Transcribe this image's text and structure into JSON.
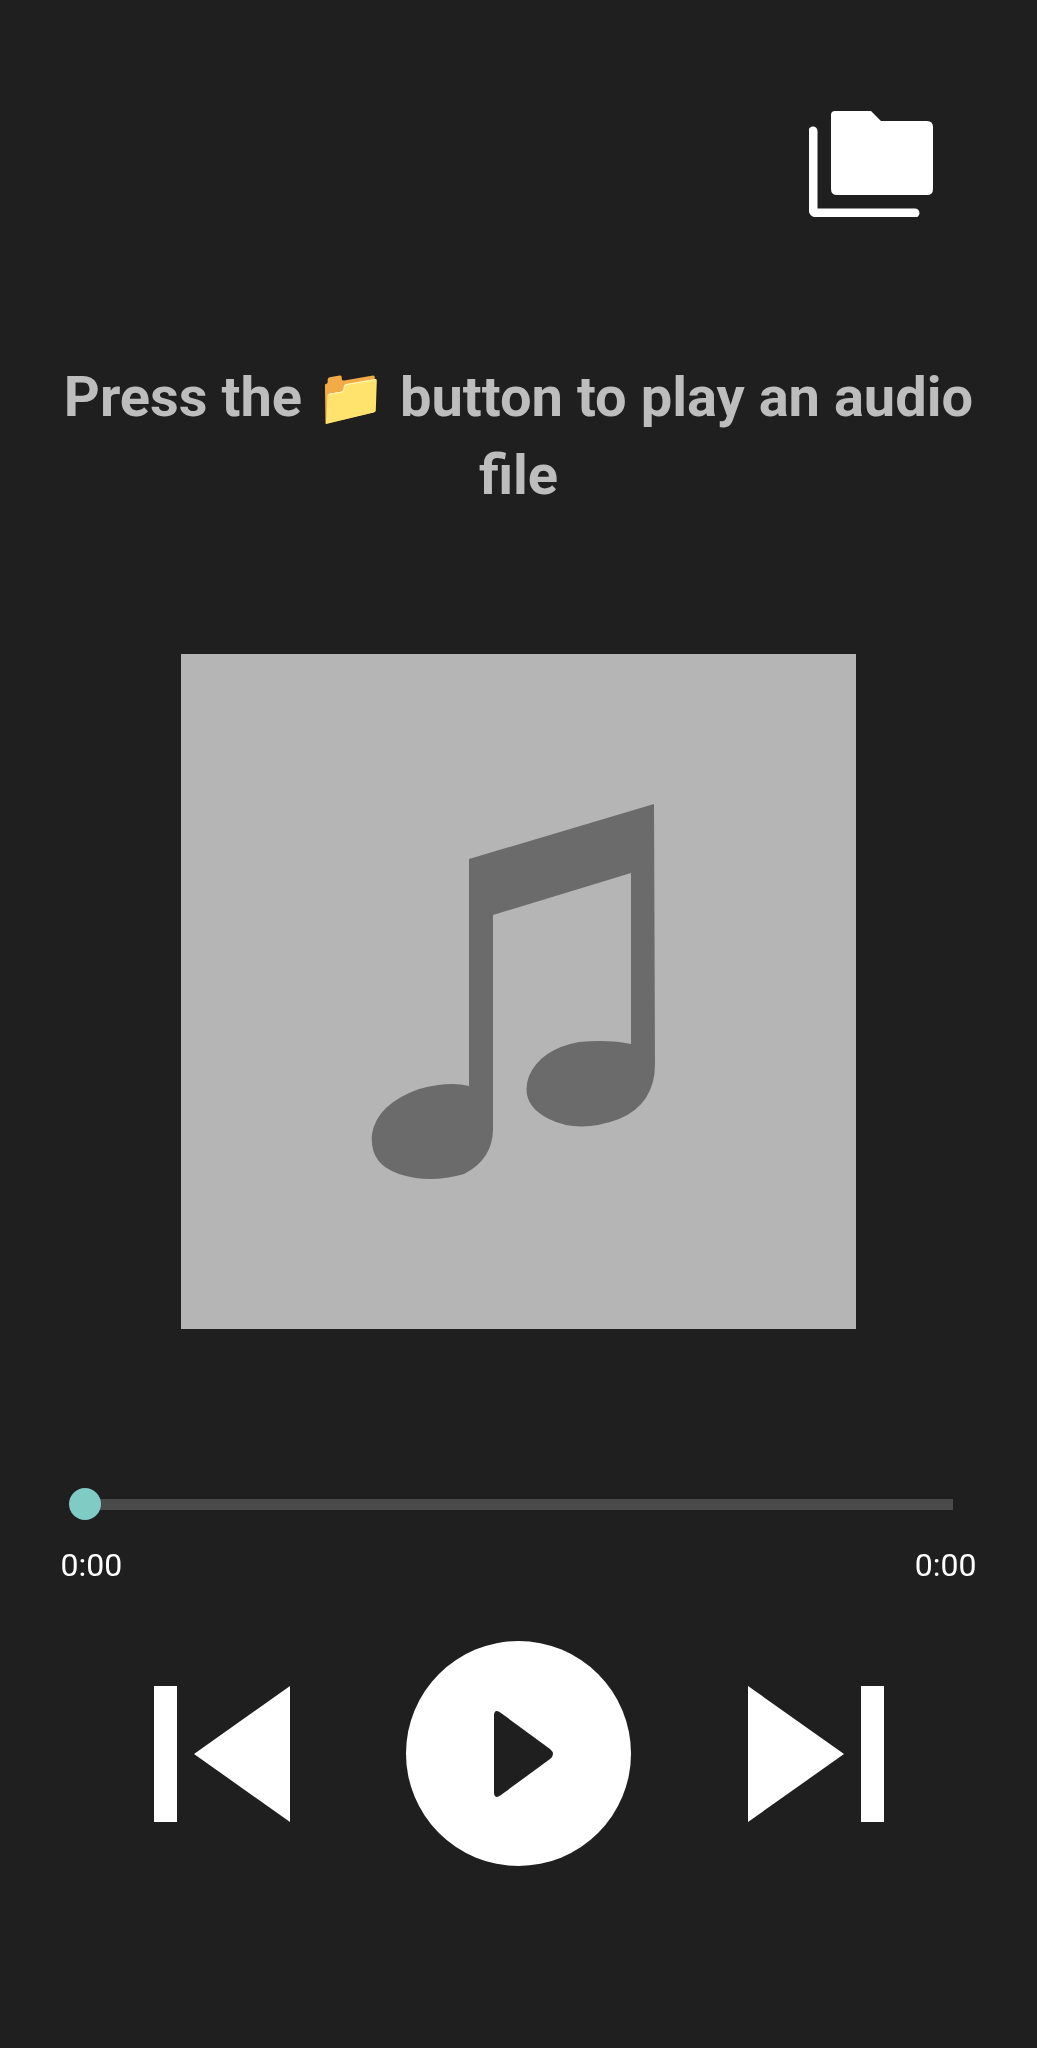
{
  "open_button": {
    "kind": "folder"
  },
  "prompt": "Press the 📁 button to play an audio file",
  "artwork": {
    "kind": "music-note"
  },
  "seek_bar": {
    "level": 0
  },
  "elapsed": "0:00",
  "duration": "0:00",
  "controls": [
    {
      "kind": "previous"
    },
    {
      "kind": "play"
    },
    {
      "kind": "next"
    }
  ]
}
